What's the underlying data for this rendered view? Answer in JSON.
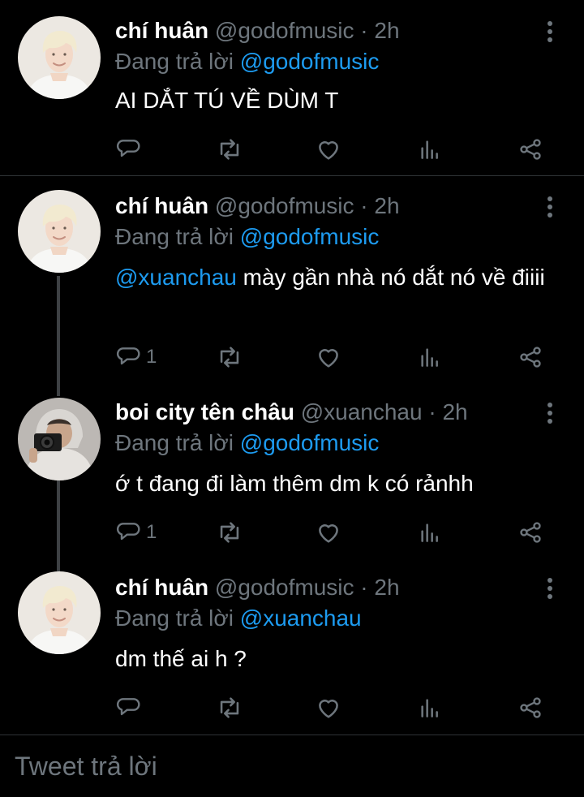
{
  "colors": {
    "background": "#000000",
    "text": "#ffffff",
    "muted": "#6e767d",
    "accent": "#1d9bf0",
    "divider": "#2f3336"
  },
  "tweets": [
    {
      "name": "chí huân",
      "handle": "@godofmusic",
      "dot": "·",
      "time": "2h",
      "reply_prefix": "Đang trả lời",
      "reply_to": "@godofmusic",
      "mention": "",
      "text": "AI DẮT TÚ VỀ DÙM T",
      "reply_count": "",
      "icons": [
        "reply-icon",
        "retweet-icon",
        "like-icon",
        "analytics-icon",
        "share-icon",
        "more-icon"
      ]
    },
    {
      "name": "chí huân",
      "handle": "@godofmusic",
      "dot": "·",
      "time": "2h",
      "reply_prefix": "Đang trả lời",
      "reply_to": "@godofmusic",
      "mention": "@xuanchau",
      "text": " mày gần nhà nó dắt nó về điiii",
      "reply_count": "1"
    },
    {
      "name": "boi city tên châu",
      "handle": "@xuanchau",
      "dot": "·",
      "time": "2h",
      "reply_prefix": "Đang trả lời",
      "reply_to": "@godofmusic",
      "mention": "",
      "text": "ớ t đang đi làm thêm dm k có rảnhh",
      "reply_count": "1"
    },
    {
      "name": "chí huân",
      "handle": "@godofmusic",
      "dot": "·",
      "time": "2h",
      "reply_prefix": "Đang trả lời",
      "reply_to": "@xuanchau",
      "mention": "",
      "text": "dm thế ai h ?",
      "reply_count": ""
    }
  ],
  "composer": {
    "placeholder": "Tweet trả lời"
  }
}
